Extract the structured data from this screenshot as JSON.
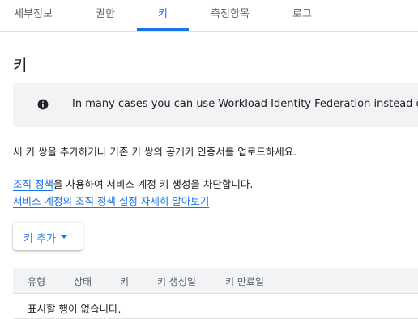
{
  "tabs": [
    {
      "label": "세부정보",
      "active": false
    },
    {
      "label": "권한",
      "active": false
    },
    {
      "label": "키",
      "active": true
    },
    {
      "label": "측정항목",
      "active": false
    },
    {
      "label": "로그",
      "active": false
    }
  ],
  "colors": {
    "accent": "#1a73e8",
    "info_bg": "#f1f3f4",
    "text": "#202124",
    "muted": "#5f6368"
  },
  "page_title": "키",
  "info": {
    "icon": "info-icon",
    "text": "In many cases you can use Workload Identity Federation instead of s"
  },
  "description": "새 키 쌍을 추가하거나 기존 키 쌍의 공개키 인증서를 업로드하세요.",
  "policy": {
    "link_text": "조직 정책",
    "rest_text": "을 사용하여 서비스 계정 키 생성을 차단합니다.",
    "learn_more": "서비스 계정의 조직 정책 설정 자세히 알아보기"
  },
  "add_key_button": {
    "label": "키 추가",
    "icon": "caret-down-icon"
  },
  "table": {
    "columns": [
      "유형",
      "상태",
      "키",
      "키 생성일",
      "키 만료일"
    ],
    "empty_message": "표시할 행이 없습니다."
  }
}
